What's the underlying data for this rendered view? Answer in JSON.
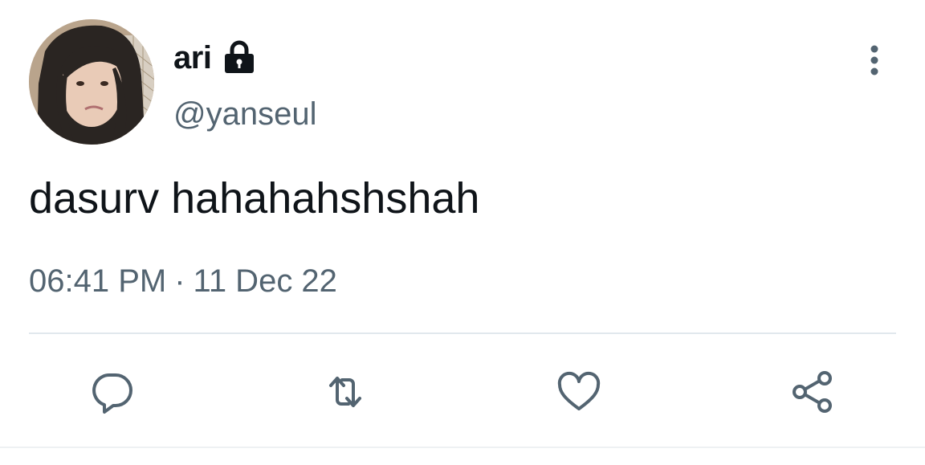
{
  "author": {
    "display_name": "ari",
    "handle": "@yanseul",
    "protected_icon": "lock-icon",
    "avatar": "avatar-photo"
  },
  "tweet": {
    "text": "dasurv hahahahshshah",
    "time": "06:41 PM",
    "separator": "·",
    "date": "11 Dec 22"
  },
  "menu_icon": "more-vertical-icon",
  "actions": [
    {
      "name": "reply",
      "icon": "reply-icon"
    },
    {
      "name": "retweet",
      "icon": "retweet-icon"
    },
    {
      "name": "like",
      "icon": "heart-icon"
    },
    {
      "name": "share",
      "icon": "share-icon"
    }
  ],
  "colors": {
    "text": "#0f1419",
    "secondary": "#536471",
    "divider": "#e1e8ed"
  }
}
